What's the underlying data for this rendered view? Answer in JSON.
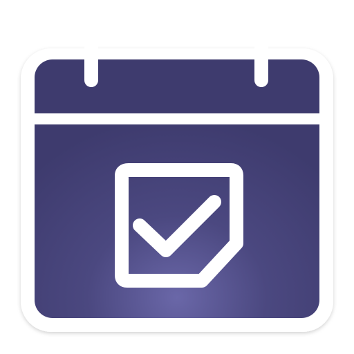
{
  "icon": {
    "name": "calendar-check-icon",
    "colors": {
      "frame": "#ffffff",
      "body_dark": "#3e3b6e",
      "body_glow": "#6a67a8",
      "stroke": "#ffffff"
    }
  }
}
